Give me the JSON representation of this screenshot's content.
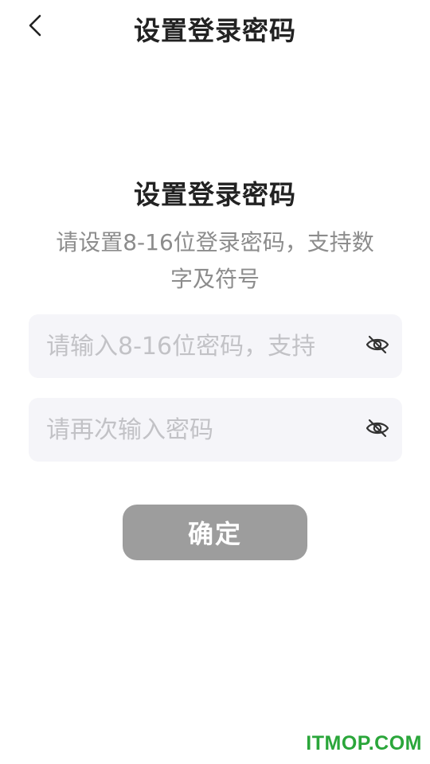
{
  "header": {
    "back_icon": "chevron-left-icon",
    "title": "设置登录密码"
  },
  "content": {
    "title": "设置登录密码",
    "subtitle": "请设置8-16位登录密码，支持数字及符号"
  },
  "form": {
    "password": {
      "placeholder": "请输入8-16位密码，支持",
      "value": "",
      "visibility_icon": "eye-off-icon"
    },
    "confirm_password": {
      "placeholder": "请再次输入密码",
      "value": "",
      "visibility_icon": "eye-off-icon"
    },
    "submit_label": "确定"
  },
  "watermark": {
    "text": "ITMOP.COM",
    "color": "#2aa63a"
  },
  "colors": {
    "button_disabled": "#9d9d9d",
    "input_bg": "#f5f5f9",
    "title_text": "#222222",
    "subtitle_text": "#8c8c8c"
  }
}
